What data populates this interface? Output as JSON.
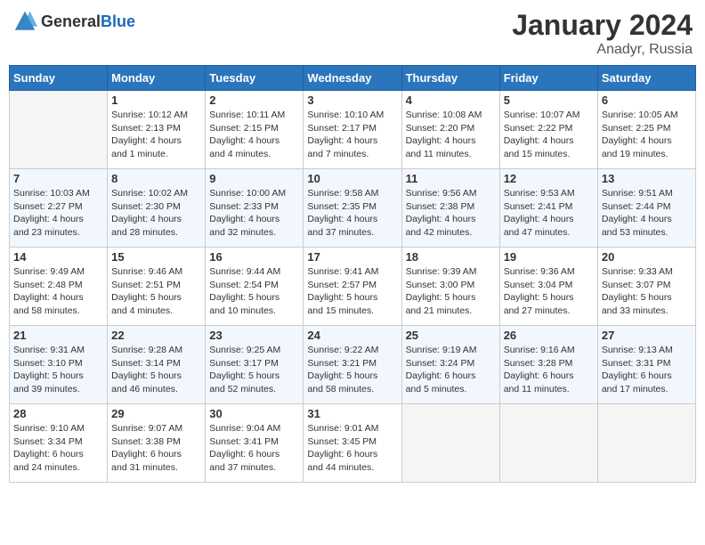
{
  "header": {
    "logo_general": "General",
    "logo_blue": "Blue",
    "month": "January 2024",
    "location": "Anadyr, Russia"
  },
  "weekdays": [
    "Sunday",
    "Monday",
    "Tuesday",
    "Wednesday",
    "Thursday",
    "Friday",
    "Saturday"
  ],
  "weeks": [
    [
      {
        "day": "",
        "info": ""
      },
      {
        "day": "1",
        "info": "Sunrise: 10:12 AM\nSunset: 2:13 PM\nDaylight: 4 hours\nand 1 minute."
      },
      {
        "day": "2",
        "info": "Sunrise: 10:11 AM\nSunset: 2:15 PM\nDaylight: 4 hours\nand 4 minutes."
      },
      {
        "day": "3",
        "info": "Sunrise: 10:10 AM\nSunset: 2:17 PM\nDaylight: 4 hours\nand 7 minutes."
      },
      {
        "day": "4",
        "info": "Sunrise: 10:08 AM\nSunset: 2:20 PM\nDaylight: 4 hours\nand 11 minutes."
      },
      {
        "day": "5",
        "info": "Sunrise: 10:07 AM\nSunset: 2:22 PM\nDaylight: 4 hours\nand 15 minutes."
      },
      {
        "day": "6",
        "info": "Sunrise: 10:05 AM\nSunset: 2:25 PM\nDaylight: 4 hours\nand 19 minutes."
      }
    ],
    [
      {
        "day": "7",
        "info": "Sunrise: 10:03 AM\nSunset: 2:27 PM\nDaylight: 4 hours\nand 23 minutes."
      },
      {
        "day": "8",
        "info": "Sunrise: 10:02 AM\nSunset: 2:30 PM\nDaylight: 4 hours\nand 28 minutes."
      },
      {
        "day": "9",
        "info": "Sunrise: 10:00 AM\nSunset: 2:33 PM\nDaylight: 4 hours\nand 32 minutes."
      },
      {
        "day": "10",
        "info": "Sunrise: 9:58 AM\nSunset: 2:35 PM\nDaylight: 4 hours\nand 37 minutes."
      },
      {
        "day": "11",
        "info": "Sunrise: 9:56 AM\nSunset: 2:38 PM\nDaylight: 4 hours\nand 42 minutes."
      },
      {
        "day": "12",
        "info": "Sunrise: 9:53 AM\nSunset: 2:41 PM\nDaylight: 4 hours\nand 47 minutes."
      },
      {
        "day": "13",
        "info": "Sunrise: 9:51 AM\nSunset: 2:44 PM\nDaylight: 4 hours\nand 53 minutes."
      }
    ],
    [
      {
        "day": "14",
        "info": "Sunrise: 9:49 AM\nSunset: 2:48 PM\nDaylight: 4 hours\nand 58 minutes."
      },
      {
        "day": "15",
        "info": "Sunrise: 9:46 AM\nSunset: 2:51 PM\nDaylight: 5 hours\nand 4 minutes."
      },
      {
        "day": "16",
        "info": "Sunrise: 9:44 AM\nSunset: 2:54 PM\nDaylight: 5 hours\nand 10 minutes."
      },
      {
        "day": "17",
        "info": "Sunrise: 9:41 AM\nSunset: 2:57 PM\nDaylight: 5 hours\nand 15 minutes."
      },
      {
        "day": "18",
        "info": "Sunrise: 9:39 AM\nSunset: 3:00 PM\nDaylight: 5 hours\nand 21 minutes."
      },
      {
        "day": "19",
        "info": "Sunrise: 9:36 AM\nSunset: 3:04 PM\nDaylight: 5 hours\nand 27 minutes."
      },
      {
        "day": "20",
        "info": "Sunrise: 9:33 AM\nSunset: 3:07 PM\nDaylight: 5 hours\nand 33 minutes."
      }
    ],
    [
      {
        "day": "21",
        "info": "Sunrise: 9:31 AM\nSunset: 3:10 PM\nDaylight: 5 hours\nand 39 minutes."
      },
      {
        "day": "22",
        "info": "Sunrise: 9:28 AM\nSunset: 3:14 PM\nDaylight: 5 hours\nand 46 minutes."
      },
      {
        "day": "23",
        "info": "Sunrise: 9:25 AM\nSunset: 3:17 PM\nDaylight: 5 hours\nand 52 minutes."
      },
      {
        "day": "24",
        "info": "Sunrise: 9:22 AM\nSunset: 3:21 PM\nDaylight: 5 hours\nand 58 minutes."
      },
      {
        "day": "25",
        "info": "Sunrise: 9:19 AM\nSunset: 3:24 PM\nDaylight: 6 hours\nand 5 minutes."
      },
      {
        "day": "26",
        "info": "Sunrise: 9:16 AM\nSunset: 3:28 PM\nDaylight: 6 hours\nand 11 minutes."
      },
      {
        "day": "27",
        "info": "Sunrise: 9:13 AM\nSunset: 3:31 PM\nDaylight: 6 hours\nand 17 minutes."
      }
    ],
    [
      {
        "day": "28",
        "info": "Sunrise: 9:10 AM\nSunset: 3:34 PM\nDaylight: 6 hours\nand 24 minutes."
      },
      {
        "day": "29",
        "info": "Sunrise: 9:07 AM\nSunset: 3:38 PM\nDaylight: 6 hours\nand 31 minutes."
      },
      {
        "day": "30",
        "info": "Sunrise: 9:04 AM\nSunset: 3:41 PM\nDaylight: 6 hours\nand 37 minutes."
      },
      {
        "day": "31",
        "info": "Sunrise: 9:01 AM\nSunset: 3:45 PM\nDaylight: 6 hours\nand 44 minutes."
      },
      {
        "day": "",
        "info": ""
      },
      {
        "day": "",
        "info": ""
      },
      {
        "day": "",
        "info": ""
      }
    ]
  ]
}
